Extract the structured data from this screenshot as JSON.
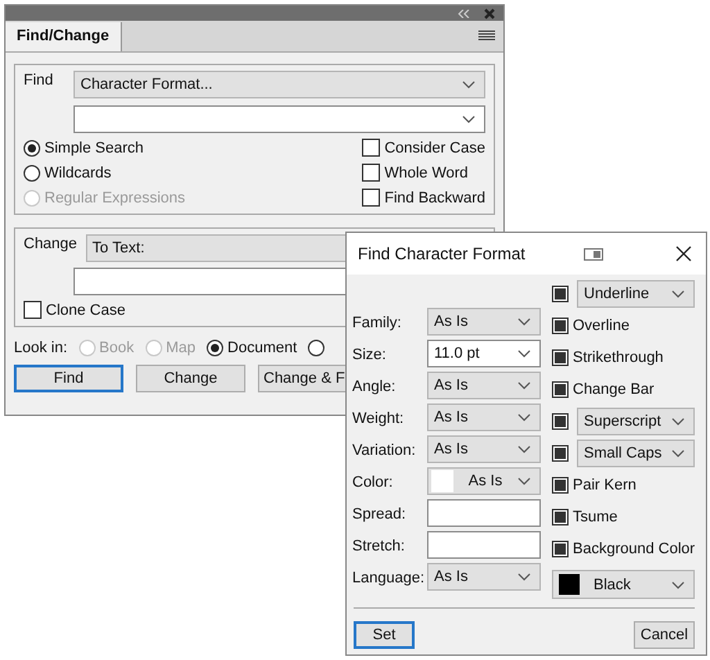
{
  "panel": {
    "tab": {
      "label": "Find/Change",
      "selected": true
    },
    "find": {
      "label": "Find",
      "mode": "Character Format..."
    },
    "search_modes": [
      {
        "label": "Simple Search",
        "selected": true,
        "disabled": false
      },
      {
        "label": "Wildcards",
        "selected": false,
        "disabled": false
      },
      {
        "label": "Regular Expressions",
        "selected": false,
        "disabled": true
      }
    ],
    "options": [
      {
        "label": "Consider Case",
        "checked": false
      },
      {
        "label": "Whole Word",
        "checked": false
      },
      {
        "label": "Find Backward",
        "checked": false
      }
    ],
    "change": {
      "label": "Change",
      "mode": "To Text:"
    },
    "clone_case": {
      "label": "Clone Case",
      "checked": false
    },
    "look_in": {
      "label": "Look in:",
      "options": [
        {
          "label": "Book",
          "selected": false,
          "disabled": true
        },
        {
          "label": "Map",
          "selected": false,
          "disabled": true
        },
        {
          "label": "Document",
          "selected": true,
          "disabled": false
        },
        {
          "selected": false,
          "disabled": false
        }
      ]
    },
    "buttons": [
      {
        "label": "Find",
        "default": true
      },
      {
        "label": "Change",
        "default": false
      },
      {
        "label": "Change & F",
        "default": false
      }
    ]
  },
  "dialog": {
    "title": "Find Character Format",
    "fields": [
      {
        "label": "Family:",
        "kind": "select",
        "value": "As Is"
      },
      {
        "label": "Size:",
        "kind": "combo",
        "value": "11.0 pt"
      },
      {
        "label": "Angle:",
        "kind": "select",
        "value": "As Is"
      },
      {
        "label": "Weight:",
        "kind": "select",
        "value": "As Is"
      },
      {
        "label": "Variation:",
        "kind": "select",
        "value": "As Is"
      },
      {
        "label": "Color:",
        "kind": "color",
        "value": "As Is",
        "color": "#ffffff"
      },
      {
        "label": "Spread:",
        "kind": "input"
      },
      {
        "label": "Stretch:",
        "kind": "input"
      },
      {
        "label": "Language:",
        "kind": "select",
        "value": "As Is"
      }
    ],
    "attributes": [
      {
        "kind": "check_select",
        "mixed": true,
        "value": "Underline"
      },
      {
        "kind": "check",
        "mixed": true,
        "label": "Overline"
      },
      {
        "kind": "check",
        "mixed": true,
        "label": "Strikethrough"
      },
      {
        "kind": "check",
        "mixed": true,
        "label": "Change Bar"
      },
      {
        "kind": "check_select",
        "mixed": true,
        "value": "Superscript"
      },
      {
        "kind": "check_select",
        "mixed": true,
        "value": "Small Caps"
      },
      {
        "kind": "check",
        "mixed": true,
        "label": "Pair Kern"
      },
      {
        "kind": "check",
        "mixed": true,
        "label": "Tsume"
      },
      {
        "kind": "check",
        "mixed": true,
        "label": "Background Color"
      },
      {
        "kind": "color",
        "value": "Black",
        "color": "#000000"
      }
    ],
    "buttons": [
      {
        "label": "Set",
        "default": true
      },
      {
        "label": "Cancel",
        "default": false
      }
    ]
  }
}
